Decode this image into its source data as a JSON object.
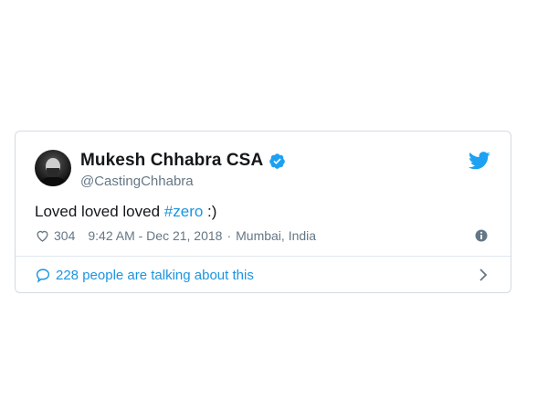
{
  "tweet": {
    "display_name": "Mukesh Chhabra CSA",
    "handle": "@CastingChhabra",
    "text_prefix": "Loved loved loved ",
    "hashtag": "#zero",
    "text_suffix": " :)",
    "likes": "304",
    "timestamp": "9:42 AM - Dec 21, 2018",
    "separator": "·",
    "location": "Mumbai, India",
    "talking": "228 people are talking about this"
  },
  "icons": {
    "avatar": "avatar",
    "verified": "verified-badge-icon",
    "bird": "twitter-bird-icon",
    "heart": "heart-icon",
    "info": "info-icon",
    "bubble": "speech-bubble-icon",
    "chevron": "chevron-right-icon"
  },
  "colors": {
    "link_blue": "#1b95e0",
    "twitter_blue": "#1da1f2",
    "text_primary": "#14171a",
    "text_secondary": "#657786",
    "border": "#d4dbe1"
  }
}
